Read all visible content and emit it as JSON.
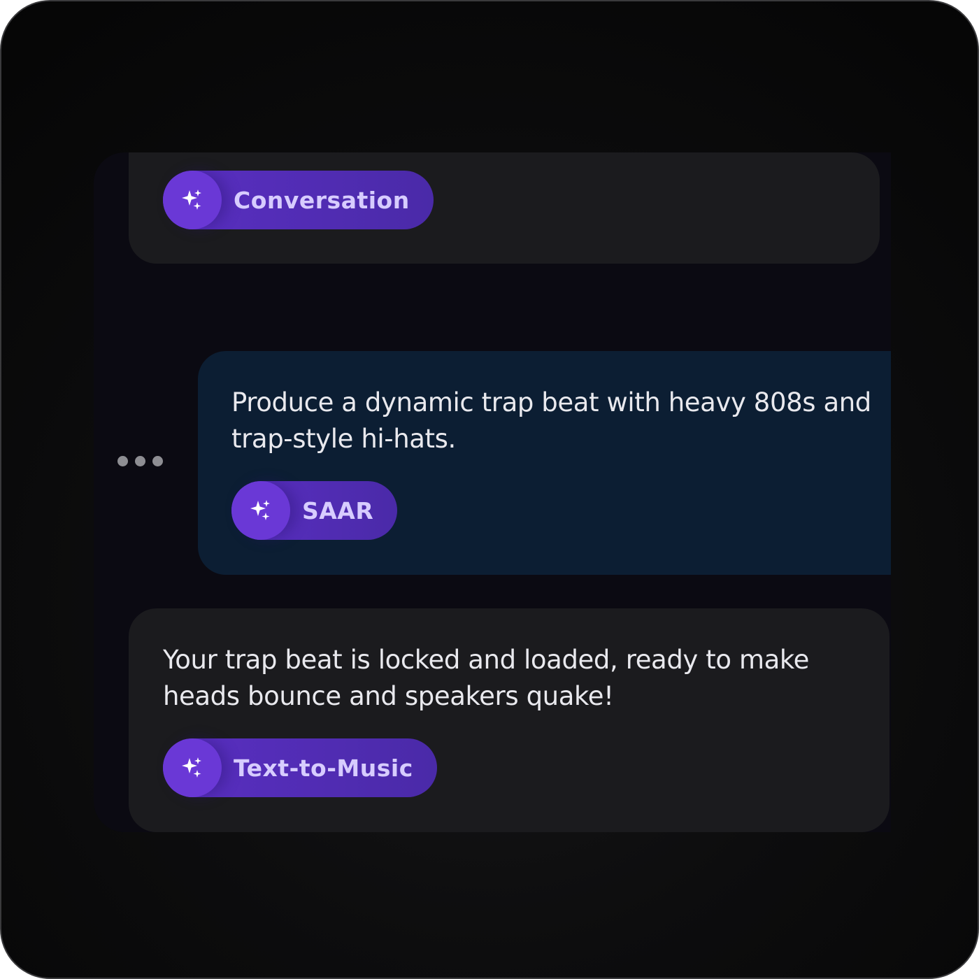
{
  "messages": [
    {
      "role": "assistant",
      "text": "",
      "tag": {
        "icon": "sparkles-icon",
        "label": "Conversation"
      }
    },
    {
      "role": "user",
      "lines": [
        "Produce a dynamic trap beat with heavy 808s and",
        "trap-style hi-hats."
      ],
      "tag": {
        "icon": "sparkles-icon",
        "label": "SAAR"
      }
    },
    {
      "role": "assistant",
      "lines": [
        "Your trap beat is locked and loaded, ready to make",
        "heads bounce and speakers quake!"
      ],
      "tag": {
        "icon": "sparkles-icon",
        "label": "Text-to-Music"
      }
    }
  ],
  "more_menu": {
    "icon": "more-dots-icon"
  },
  "colors": {
    "background": "#0b0a12",
    "assistant_card": "#1b1b1e",
    "user_card": "#0c1e33",
    "tag_accent": "#6a38d6",
    "tag_text": "#d7ccff"
  }
}
